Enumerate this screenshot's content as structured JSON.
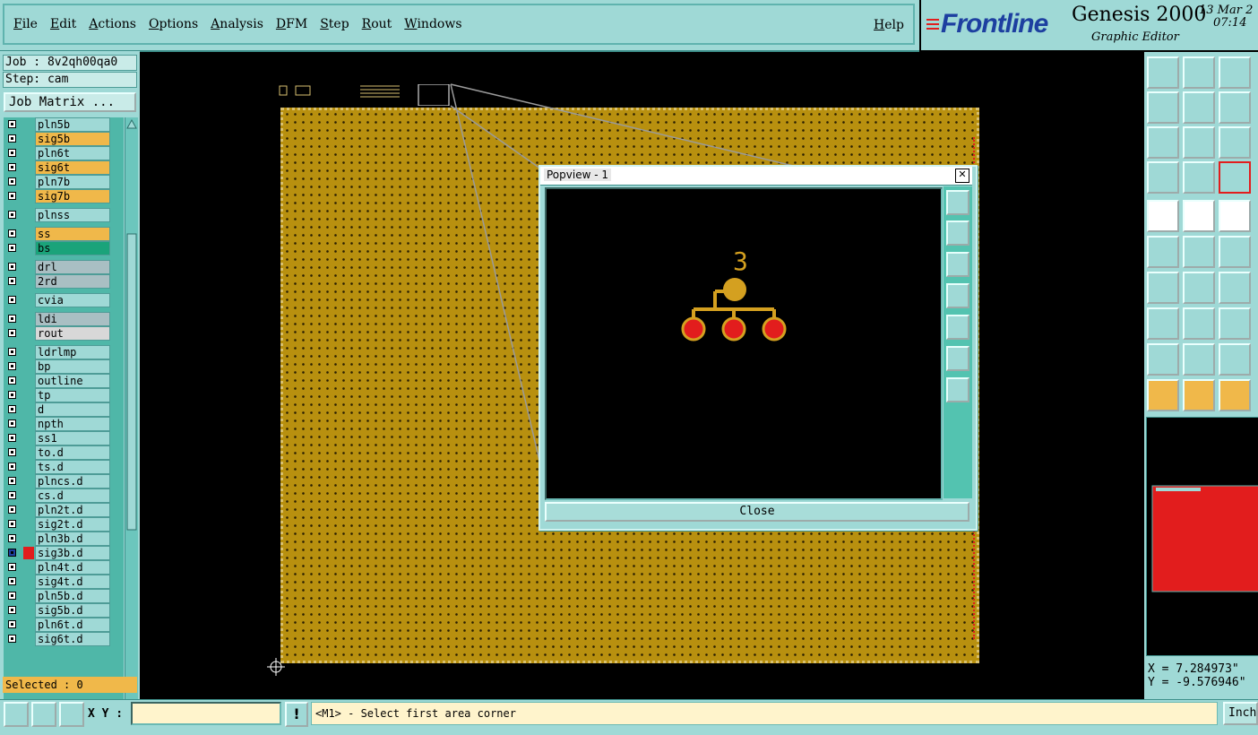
{
  "menu": [
    "File",
    "Edit",
    "Actions",
    "Options",
    "Analysis",
    "DFM",
    "Step",
    "Rout",
    "Windows"
  ],
  "help_label": "Help",
  "brand": {
    "logo": "Frontline",
    "app_name": "Genesis 2000",
    "app_sub": "Graphic Editor",
    "date": "13 Mar 2",
    "time": "07:14"
  },
  "job": {
    "job_line": "Job : 8v2qh00qa0",
    "step_line": "Step: cam",
    "matrix_button": "Job Matrix ..."
  },
  "layers": [
    {
      "name": "pln5b",
      "color": "#9fd9d6"
    },
    {
      "name": "sig5b",
      "color": "#f0b84a"
    },
    {
      "name": "pln6t",
      "color": "#9fd9d6"
    },
    {
      "name": "sig6t",
      "color": "#f0b84a"
    },
    {
      "name": "pln7b",
      "color": "#9fd9d6"
    },
    {
      "name": "sig7b",
      "color": "#f0b84a"
    },
    {
      "name": "plnss",
      "color": "#9fd9d6"
    },
    {
      "name": "ss",
      "color": "#f0b84a"
    },
    {
      "name": "bs",
      "color": "#1aa37a"
    },
    {
      "name": "drl",
      "color": "#a9bfc3"
    },
    {
      "name": "2rd",
      "color": "#a9bfc3"
    },
    {
      "name": "cvia",
      "color": "#9fd9d6"
    },
    {
      "name": "ldi",
      "color": "#a9bfc3"
    },
    {
      "name": "rout",
      "color": "#d8d8d8"
    },
    {
      "name": "ldrlmp",
      "color": "#9fd9d6"
    },
    {
      "name": "bp",
      "color": "#9fd9d6"
    },
    {
      "name": "outline",
      "color": "#9fd9d6"
    },
    {
      "name": "tp",
      "color": "#9fd9d6"
    },
    {
      "name": "d",
      "color": "#9fd9d6"
    },
    {
      "name": "npth",
      "color": "#9fd9d6"
    },
    {
      "name": "ss1",
      "color": "#9fd9d6"
    },
    {
      "name": "to.d",
      "color": "#9fd9d6"
    },
    {
      "name": "ts.d",
      "color": "#9fd9d6"
    },
    {
      "name": "plncs.d",
      "color": "#9fd9d6"
    },
    {
      "name": "cs.d",
      "color": "#9fd9d6"
    },
    {
      "name": "pln2t.d",
      "color": "#9fd9d6"
    },
    {
      "name": "sig2t.d",
      "color": "#9fd9d6"
    },
    {
      "name": "pln3b.d",
      "color": "#9fd9d6"
    },
    {
      "name": "sig3b.d",
      "color": "#9fd9d6"
    },
    {
      "name": "pln4t.d",
      "color": "#9fd9d6"
    },
    {
      "name": "sig4t.d",
      "color": "#9fd9d6"
    },
    {
      "name": "pln5b.d",
      "color": "#9fd9d6"
    },
    {
      "name": "sig5b.d",
      "color": "#9fd9d6"
    },
    {
      "name": "pln6t.d",
      "color": "#9fd9d6"
    },
    {
      "name": "sig6t.d",
      "color": "#9fd9d6"
    }
  ],
  "selected_label": "Selected : 0",
  "popview": {
    "title": "Popview - 1",
    "label": "3",
    "close_label": "Close"
  },
  "coords": {
    "x": "X = 7.284973\"",
    "y": "Y = -9.576946\""
  },
  "bottom": {
    "xy_label": "X Y :",
    "xy_value": "",
    "status": "<M1> - Select first area corner",
    "units": "Inch"
  },
  "colors": {
    "panel": "#9fd9d6",
    "board": "#b8900f",
    "highlight": "#f0b84a",
    "active_layer": "#e21d1d"
  }
}
